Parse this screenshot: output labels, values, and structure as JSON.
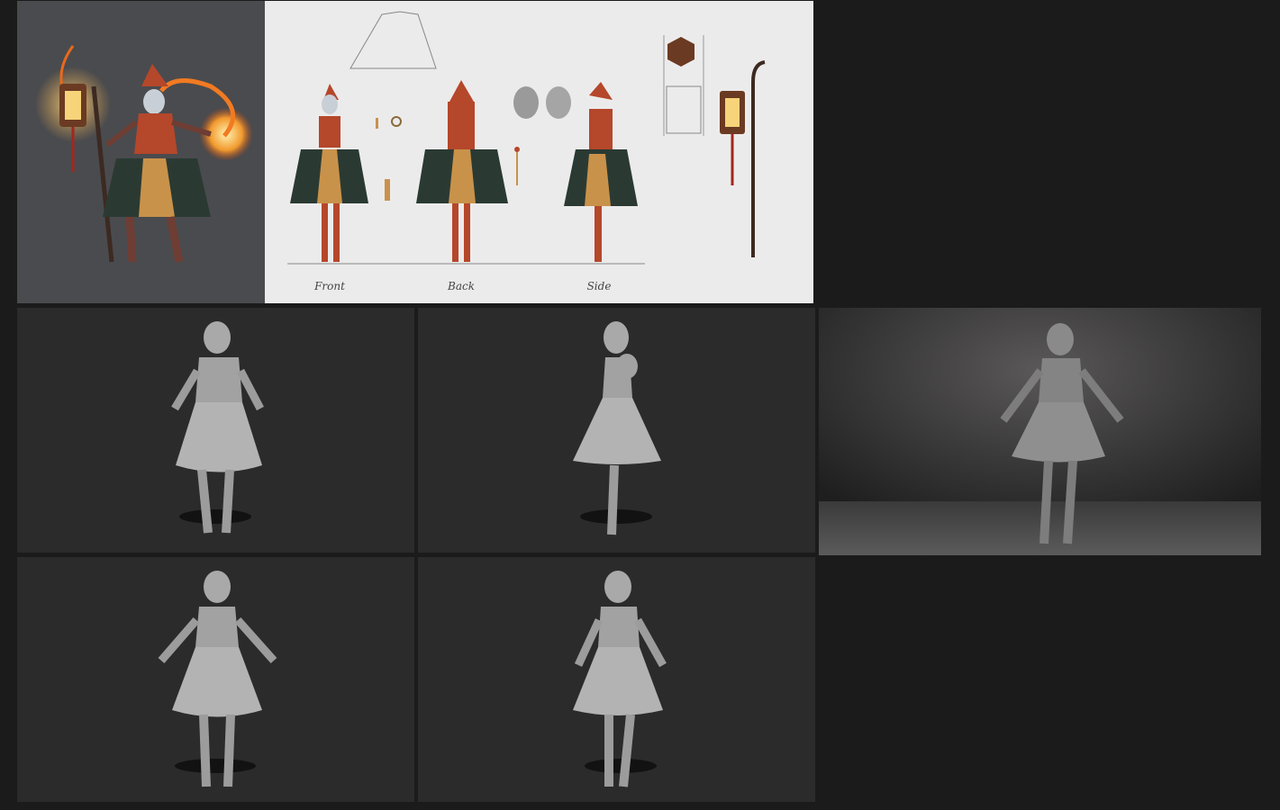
{
  "turnaround_labels": {
    "front": "Front",
    "back": "Back",
    "side": "Side"
  },
  "palette": {
    "background": "#1b1b1b",
    "concept_background": "#4a4b4e",
    "sheet_background": "#ecebeb",
    "clay_viewport": "#2b2b2b",
    "clay_model": "#a9a9a9",
    "hood_red": "#b5472b",
    "skirt_dark": "#2a3a33",
    "skirt_gold": "#c9924a",
    "flame_orange": "#f29a2e"
  }
}
